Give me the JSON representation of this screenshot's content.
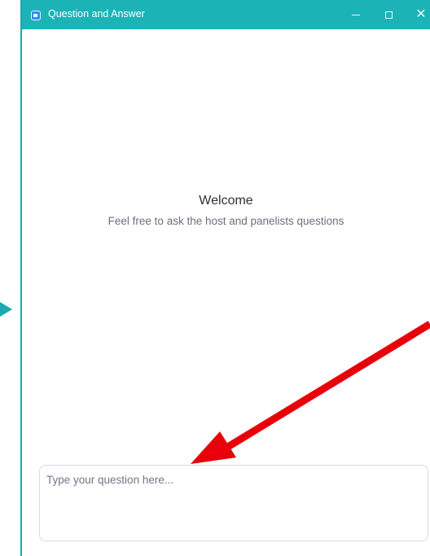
{
  "window": {
    "title": "Question and Answer",
    "accent_color": "#1cb3b6"
  },
  "titlebar_controls": {
    "minimize_icon": "minimize-icon",
    "maximize_icon": "maximize-icon",
    "close_icon": "close-icon",
    "close_glyph": "✕"
  },
  "welcome": {
    "title": "Welcome",
    "subtitle": "Feel free to ask the host and panelists questions"
  },
  "question_input": {
    "placeholder": "Type your question here...",
    "value": ""
  },
  "annotations": {
    "arrow_color": "#e8000b",
    "side_marker_color": "#1aa9b3"
  }
}
